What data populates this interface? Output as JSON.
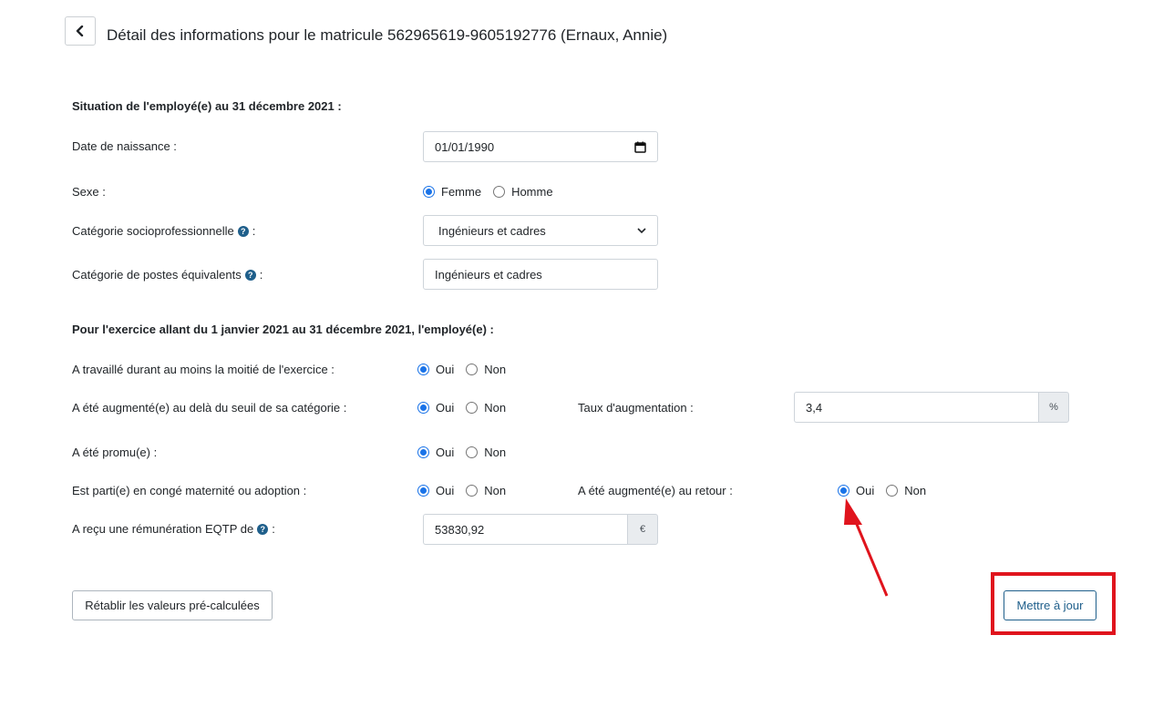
{
  "header": {
    "title": "Détail des informations pour le matricule 562965619-9605192776 (Ernaux, Annie)"
  },
  "section1": {
    "title": "Situation de l'employé(e) au 31 décembre 2021 :",
    "birthdate_label": "Date de naissance :",
    "birthdate_value": "01/01/1990",
    "sex_label": "Sexe :",
    "sex_options": [
      "Femme",
      "Homme"
    ],
    "csp_label": "Catégorie socioprofessionnelle",
    "csp_value": "Ingénieurs et cadres",
    "equiv_label": "Catégorie de postes équivalents",
    "equiv_value": "Ingénieurs et cadres",
    "colon": ":"
  },
  "section2": {
    "title": "Pour l'exercice allant du 1 janvier 2021 au 31 décembre 2021, l'employé(e) :",
    "worked_label": "A travaillé durant au moins la moitié de l'exercice :",
    "raised_label": "A été augmenté(e) au delà du seuil de sa catégorie :",
    "rate_label": "Taux d'augmentation :",
    "rate_value": "3,4",
    "rate_unit": "%",
    "promoted_label": "A été promu(e) :",
    "leave_label": "Est parti(e) en congé maternité ou adoption :",
    "return_raise_label": "A été augmenté(e) au retour :",
    "salary_label": "A reçu une rémunération EQTP de",
    "salary_value": "53830,92",
    "salary_unit": "€",
    "yes": "Oui",
    "no": "Non",
    "colon": ":"
  },
  "actions": {
    "reset_label": "Rétablir les valeurs pré-calculées",
    "update_label": "Mettre à jour"
  },
  "icons": {
    "back": "chevron-left-icon",
    "help": "question-circle-icon",
    "calendar": "calendar-icon",
    "dropdown": "chevron-down-icon"
  },
  "colors": {
    "accent": "#1f5f8b",
    "radio": "#1a73e8",
    "annotation": "#e0141d"
  }
}
